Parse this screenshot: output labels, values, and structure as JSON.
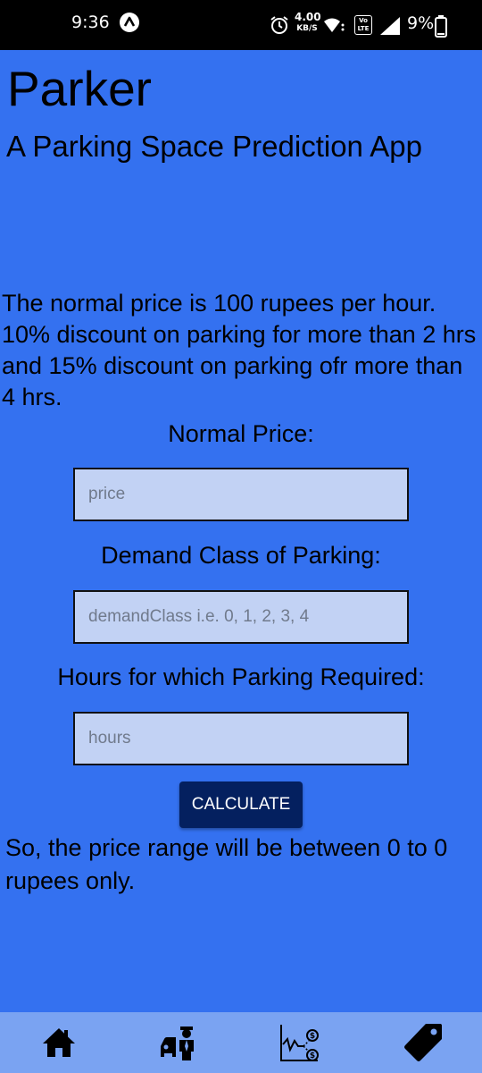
{
  "status_bar": {
    "time": "9:36",
    "net_speed_value": "4.00",
    "net_speed_unit": "KB/S",
    "volte_label": "Vo LTE",
    "battery_percent": "9%"
  },
  "app": {
    "title": "Parker",
    "subtitle": "A Parking Space Prediction App"
  },
  "info_text": "The normal price is 100 rupees per hour. 10% discount on parking for more than 2 hrs and 15% discount on parking ofr more than 4 hrs.",
  "form": {
    "price_label": "Normal Price:",
    "price_placeholder": "price",
    "price_value": "",
    "demand_label": "Demand Class of Parking:",
    "demand_placeholder": "demandClass i.e. 0, 1, 2, 3, 4",
    "demand_value": "",
    "hours_label": "Hours for which Parking Required:",
    "hours_placeholder": "hours",
    "hours_value": "",
    "calculate_label": "CALCULATE"
  },
  "result_text": "So, the price range will be between 0 to 0 rupees only.",
  "bottom_nav": {
    "items": [
      {
        "icon": "home-icon"
      },
      {
        "icon": "car-attendant-icon"
      },
      {
        "icon": "price-chart-icon"
      },
      {
        "icon": "price-tag-icon"
      }
    ]
  },
  "colors": {
    "background": "#3471f0",
    "input_background": "#c2d2f4",
    "button_background": "#04205f",
    "bottom_nav_background": "#7aa3f2",
    "status_bar": "#000000"
  }
}
